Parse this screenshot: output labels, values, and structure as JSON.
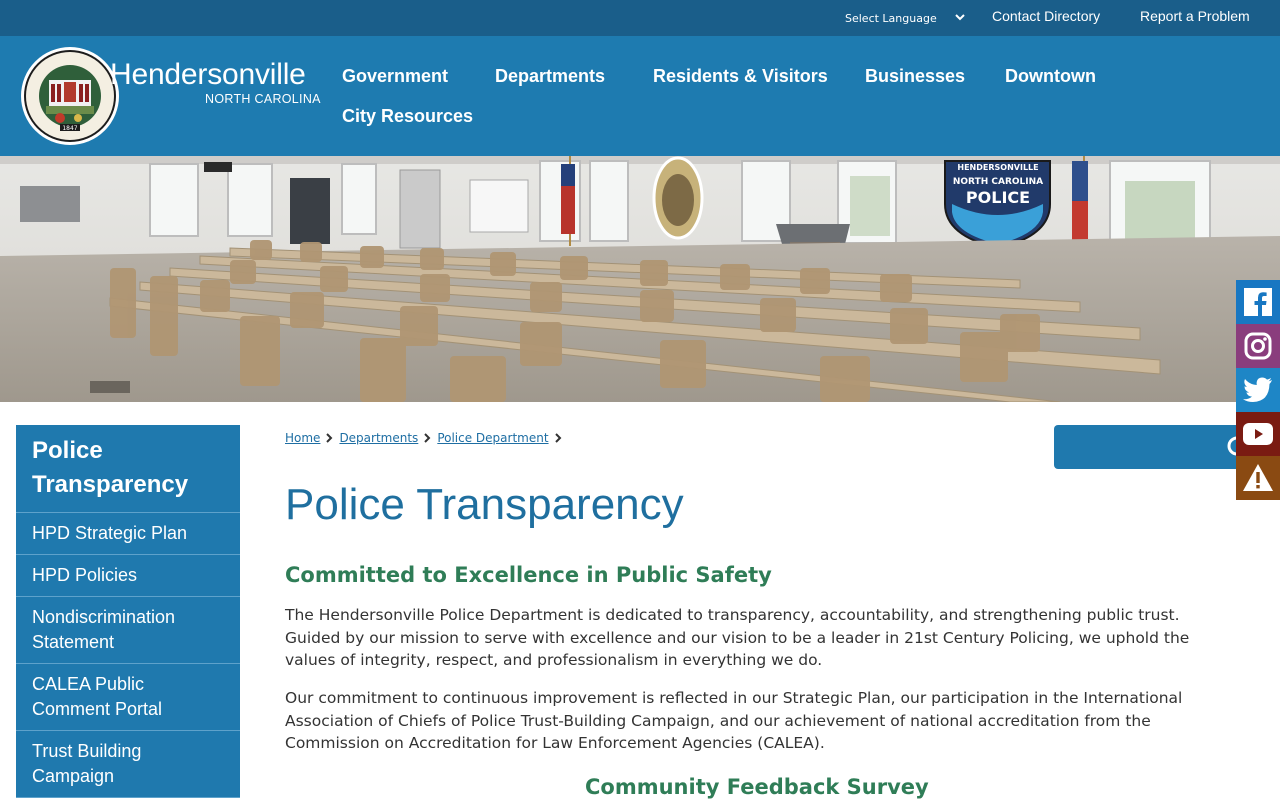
{
  "topbar": {
    "language_label": "Select Language",
    "contact": "Contact Directory",
    "report": "Report a Problem"
  },
  "brand": {
    "name": "Hendersonville",
    "state": "NORTH CAROLINA",
    "seal_year": "1847",
    "seal_text": "THE CITY OF HENDERSONVILLE N.C."
  },
  "nav": [
    "Government",
    "Departments",
    "Residents & Visitors",
    "Businesses",
    "Downtown",
    "City Resources"
  ],
  "hero": {
    "badge_top": "HENDERSONVILLE",
    "badge_mid": "NORTH CAROLINA",
    "badge_word": "POLICE"
  },
  "sidebar": {
    "title": "Police Transparency",
    "items": [
      "HPD Strategic Plan",
      "HPD Policies",
      "Nondiscrimination Statement",
      "CALEA Public Comment Portal",
      "Trust Building Campaign"
    ]
  },
  "breadcrumb": [
    "Home",
    "Departments",
    "Police Department"
  ],
  "main": {
    "title": "Police Transparency",
    "heading1": "Committed to Excellence in Public Safety",
    "para1": "The Hendersonville Police Department is dedicated to transparency, accountability, and strengthening public trust. Guided by our mission to serve with excellence and our vision to be a leader in 21st Century Policing, we uphold the values of integrity, respect, and professionalism in everything we do.",
    "para2": "Our commitment to continuous improvement is reflected in our Strategic Plan, our participation in the International Association of Chiefs of Police Trust-Building Campaign, and our achievement of national accreditation from the Commission on Accreditation for Law Enforcement Agencies (CALEA).",
    "heading2": "Community Feedback Survey"
  },
  "social": [
    {
      "icon": "facebook-icon",
      "color": "#1877c2"
    },
    {
      "icon": "instagram-icon",
      "color": "#8a3d7d"
    },
    {
      "icon": "twitter-icon",
      "color": "#1e86c6"
    },
    {
      "icon": "youtube-icon",
      "color": "#7a1b12"
    },
    {
      "icon": "alert-icon",
      "color": "#8a4a12"
    }
  ],
  "colors": {
    "topbar": "#1a5e8a",
    "header": "#1e7bb0",
    "sidebar": "#1f79ae",
    "title": "#1f6f9f",
    "heading": "#2f7d57"
  }
}
